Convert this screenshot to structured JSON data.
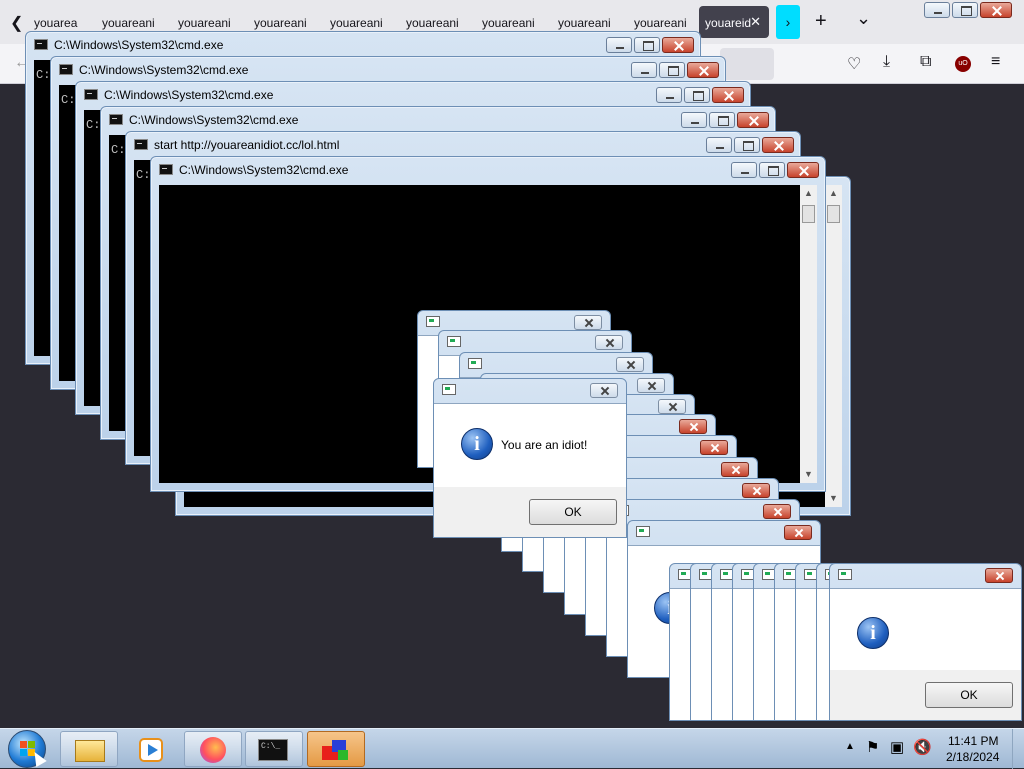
{
  "browser": {
    "tabs": [
      "youareani",
      "youareani",
      "youareani",
      "youareani",
      "youareani",
      "youareani",
      "youareani",
      "youareani",
      "youareani"
    ],
    "active_tab": "youareid",
    "new_tab": "+",
    "list_tabs": "⌄"
  },
  "cmd_windows": [
    {
      "title": "C:\\Windows\\System32\\cmd.exe",
      "prompt": "C:"
    },
    {
      "title": "C:\\Windows\\System32\\cmd.exe",
      "prompt": "C:"
    },
    {
      "title": "C:\\Windows\\System32\\cmd.exe",
      "prompt": "C:"
    },
    {
      "title": "C:\\Windows\\System32\\cmd.exe",
      "prompt": "C:"
    },
    {
      "title": "start  http://youareanidiot.cc/lol.html",
      "prompt": "C:"
    },
    {
      "title": "C:\\Windows\\System32\\cmd.exe",
      "prompt": ""
    }
  ],
  "message": {
    "text": "You are an idiot!",
    "ok_label": "OK",
    "icon": "info-icon"
  },
  "bottom_message": {
    "ok_label": "OK"
  },
  "taskbar": {
    "apps": [
      "start-orb",
      "file-explorer",
      "media-player",
      "firefox",
      "cmd",
      "paint-app"
    ],
    "time": "11:41 PM",
    "date": "2/18/2024"
  }
}
